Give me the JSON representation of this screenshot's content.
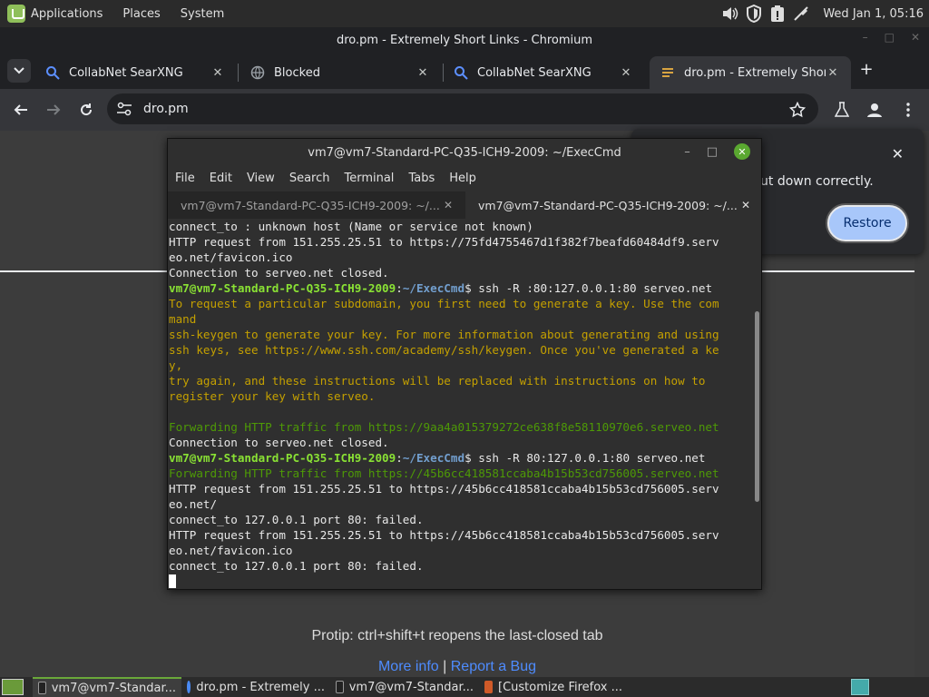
{
  "panel": {
    "menus": [
      "Applications",
      "Places",
      "System"
    ],
    "clock": "Wed Jan  1, 05:16"
  },
  "browser": {
    "window_title": "dro.pm - Extremely Short Links - Chromium",
    "tabs": [
      {
        "title": "CollabNet SearXNG",
        "icon": "search-icon"
      },
      {
        "title": "Blocked",
        "icon": "globe-icon"
      },
      {
        "title": "CollabNet SearXNG",
        "icon": "search-icon"
      },
      {
        "title": "dro.pm - Extremely Short Links",
        "icon": "site-icon"
      }
    ],
    "url": "dro.pm"
  },
  "page": {
    "protip": "Protip: ctrl+shift+t reopens the last-closed tab",
    "link_more": "More info",
    "link_sep": "|",
    "link_bug": "Report a Bug"
  },
  "restore_popup": {
    "text": "ut down correctly.",
    "button": "Restore"
  },
  "terminal": {
    "title": "vm7@vm7-Standard-PC-Q35-ICH9-2009: ~/ExecCmd",
    "menu": [
      "File",
      "Edit",
      "View",
      "Search",
      "Terminal",
      "Tabs",
      "Help"
    ],
    "tabs": [
      "vm7@vm7-Standard-PC-Q35-ICH9-2009: ~/...",
      "vm7@vm7-Standard-PC-Q35-ICH9-2009: ~/..."
    ],
    "prompt_user": "vm7@vm7-Standard-PC-Q35-ICH9-2009",
    "prompt_sep": ":",
    "prompt_path": "~/ExecCmd",
    "prompt_dollar": "$",
    "lines": [
      {
        "type": "plain",
        "text": "connect_to : unknown host (Name or service not known)"
      },
      {
        "type": "plain",
        "text": "HTTP request from 151.255.25.51 to https://75fd4755467d1f382f7beafd60484df9.serv"
      },
      {
        "type": "plain",
        "text": "eo.net/favicon.ico"
      },
      {
        "type": "plain",
        "text": "Connection to serveo.net closed."
      },
      {
        "type": "prompt",
        "text": " ssh -R :80:127.0.0.1:80 serveo.net"
      },
      {
        "type": "yellow",
        "text": "To request a particular subdomain, you first need to generate a key. Use the com"
      },
      {
        "type": "yellow",
        "text": "mand"
      },
      {
        "type": "yellow",
        "text": "ssh-keygen to generate your key. For more information about generating and using"
      },
      {
        "type": "yellow",
        "text": "ssh keys, see https://www.ssh.com/academy/ssh/keygen. Once you've generated a ke"
      },
      {
        "type": "yellow",
        "text": "y,"
      },
      {
        "type": "yellow",
        "text": "try again, and these instructions will be replaced with instructions on how to"
      },
      {
        "type": "yellow",
        "text": "register your key with serveo."
      },
      {
        "type": "plain",
        "text": ""
      },
      {
        "type": "green",
        "text": "Forwarding HTTP traffic from https://9aa4a015379272ce638f8e58110970e6.serveo.net"
      },
      {
        "type": "plain",
        "text": "Connection to serveo.net closed."
      },
      {
        "type": "prompt",
        "text": " ssh -R 80:127.0.0.1:80 serveo.net"
      },
      {
        "type": "green",
        "text": "Forwarding HTTP traffic from https://45b6cc418581ccaba4b15b53cd756005.serveo.net"
      },
      {
        "type": "plain",
        "text": "HTTP request from 151.255.25.51 to https://45b6cc418581ccaba4b15b53cd756005.serv"
      },
      {
        "type": "plain",
        "text": "eo.net/"
      },
      {
        "type": "plain",
        "text": "connect_to 127.0.0.1 port 80: failed."
      },
      {
        "type": "plain",
        "text": "HTTP request from 151.255.25.51 to https://45b6cc418581ccaba4b15b53cd756005.serv"
      },
      {
        "type": "plain",
        "text": "eo.net/favicon.ico"
      },
      {
        "type": "plain",
        "text": "connect_to 127.0.0.1 port 80: failed."
      }
    ]
  },
  "taskbar": {
    "tasks": [
      {
        "label": "vm7@vm7-Standar...",
        "icon": "terminal-icon",
        "active": true
      },
      {
        "label": "dro.pm - Extremely ...",
        "icon": "chromium-icon",
        "active": false
      },
      {
        "label": "vm7@vm7-Standar...",
        "icon": "terminal-icon",
        "active": false
      },
      {
        "label": "[Customize Firefox ...",
        "icon": "firefox-icon",
        "active": false
      }
    ]
  },
  "colors": {
    "terminal_prompt": "#8ae234",
    "terminal_path": "#729fcf",
    "terminal_warning": "#c4a000",
    "terminal_forward": "#4e9a06",
    "restore_button": "#a8c7fa",
    "link": "#4e8cff"
  }
}
